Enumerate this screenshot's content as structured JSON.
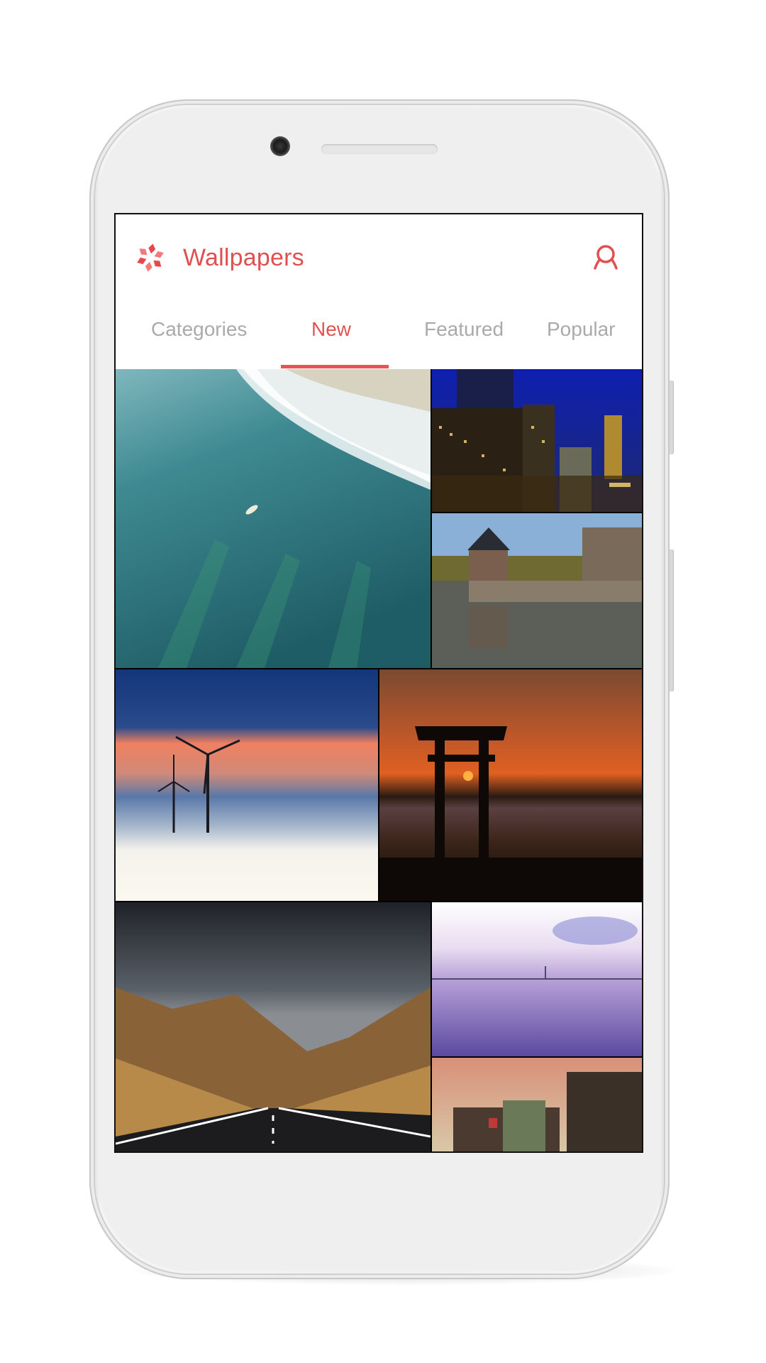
{
  "app": {
    "title": "Wallpapers",
    "logo_icon": "flower-logo-icon",
    "profile_icon": "user-profile-icon",
    "accent_color": "#e05050"
  },
  "tabs": [
    {
      "label": "Categories",
      "active": false
    },
    {
      "label": "New",
      "active": true
    },
    {
      "label": "Featured",
      "active": false
    },
    {
      "label": "Popular",
      "active": false
    }
  ],
  "wallpapers": [
    {
      "name": "surfer-ocean-wave",
      "description": "Aerial view of surfer on turquoise ocean wave"
    },
    {
      "name": "city-skyline-night",
      "description": "City skyscrapers lit at dusk"
    },
    {
      "name": "castle-moat-reflection",
      "description": "Brick castle reflected in moat"
    },
    {
      "name": "wind-turbines-fog",
      "description": "Wind turbines above fog at sunset"
    },
    {
      "name": "torii-gate-sunset",
      "description": "Torii gate silhouette against sunset over water"
    },
    {
      "name": "mountain-road",
      "description": "Road leading into mountains under dark clouds"
    },
    {
      "name": "bridge-purple-sea",
      "description": "Cable bridge over purple-tinted sea"
    },
    {
      "name": "designer-outlet-building",
      "description": "Shopping outlet building at sunset"
    }
  ]
}
